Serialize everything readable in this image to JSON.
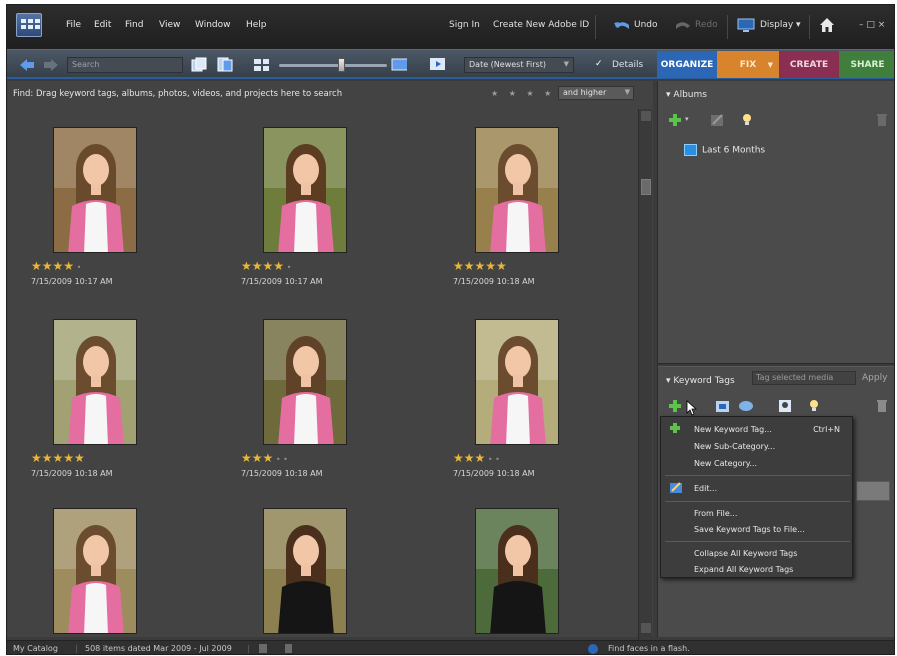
{
  "menubar": {
    "items": [
      "File",
      "Edit",
      "Find",
      "View",
      "Window",
      "Help"
    ],
    "sign_in": "Sign In",
    "create_id": "Create New Adobe ID",
    "undo": "Undo",
    "redo": "Redo",
    "display": "Display",
    "window_controls": "– □ ×"
  },
  "toolbar": {
    "search_placeholder": "Search",
    "sort_value": "Date (Newest First)",
    "details_label": "Details",
    "details_checked": true
  },
  "tabs": [
    {
      "label": "ORGANIZE"
    },
    {
      "label": "FIX"
    },
    {
      "label": "CREATE"
    },
    {
      "label": "SHARE"
    }
  ],
  "browser": {
    "find_text": "Find: Drag keyword tags, albums, photos, videos, and projects here to search",
    "star_filter": "★ ★ ★ ★ ★",
    "rating_filter": "and higher",
    "photos": [
      {
        "stars": 4,
        "date": "7/15/2009 10:17 AM"
      },
      {
        "stars": 4,
        "date": "7/15/2009 10:17 AM"
      },
      {
        "stars": 5,
        "date": "7/15/2009 10:18 AM"
      },
      {
        "stars": 5,
        "date": "7/15/2009 10:18 AM"
      },
      {
        "stars": 3,
        "date": "7/15/2009 10:18 AM"
      },
      {
        "stars": 3,
        "date": "7/15/2009 10:18 AM"
      },
      {
        "stars": 0,
        "date": ""
      },
      {
        "stars": 0,
        "date": ""
      },
      {
        "stars": 0,
        "date": ""
      }
    ]
  },
  "albums": {
    "header": "Albums",
    "items": [
      {
        "label": "Last 6 Months"
      }
    ]
  },
  "keyword_tags": {
    "header": "Keyword Tags",
    "placeholder": "Tag selected media",
    "apply": "Apply",
    "menu": {
      "new_keyword_tag": "New Keyword Tag...",
      "new_keyword_tag_shortcut": "Ctrl+N",
      "new_sub_category": "New Sub-Category...",
      "new_category": "New Category...",
      "edit": "Edit...",
      "from_file": "From File...",
      "save_to_file": "Save Keyword Tags to File...",
      "collapse_all": "Collapse All Keyword Tags",
      "expand_all": "Expand All Keyword Tags"
    }
  },
  "status": {
    "catalog": "My Catalog",
    "items": "508 items dated Mar 2009 - Jul 2009",
    "tip": "Find faces in a flash."
  },
  "colors": {
    "organize": "#2b67b5",
    "fix": "#d7842d",
    "create": "#8b2f52",
    "share": "#3f7e3d",
    "star": "#e8b73a"
  }
}
